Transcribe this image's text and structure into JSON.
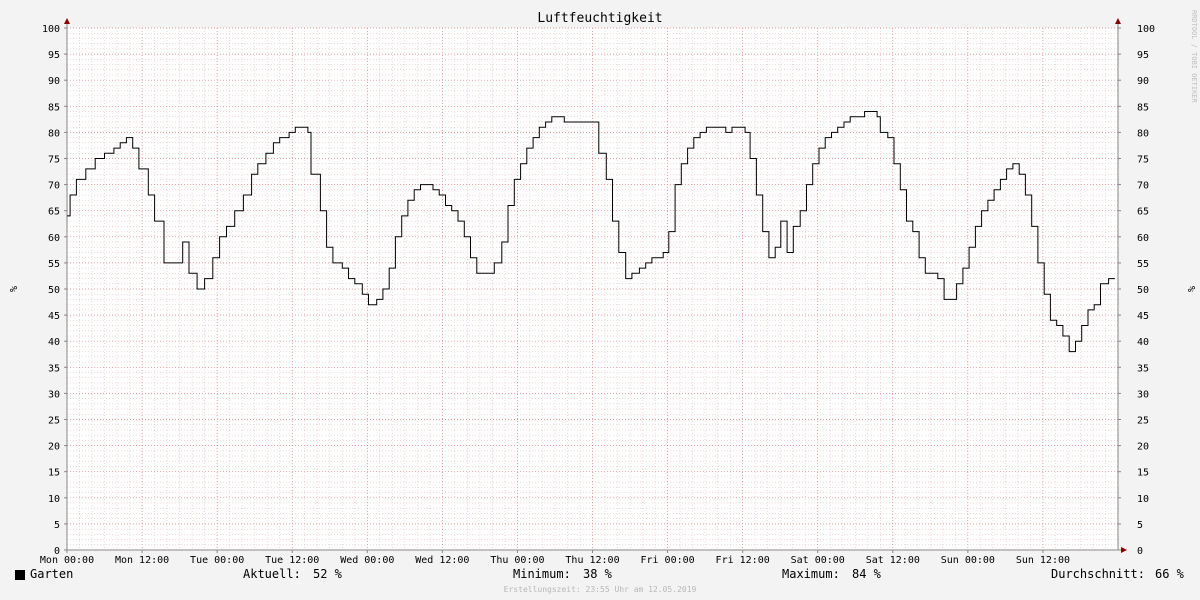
{
  "chart_data": {
    "type": "line",
    "title": "Luftfeuchtigkeit",
    "ylabel_left": "%",
    "ylabel_right": "%",
    "ylim": [
      0,
      100
    ],
    "yticks": [
      0,
      5,
      10,
      15,
      20,
      25,
      30,
      35,
      40,
      45,
      50,
      55,
      60,
      65,
      70,
      75,
      80,
      85,
      90,
      95,
      100
    ],
    "x_tick_labels": [
      "Mon 00:00",
      "Mon 12:00",
      "Tue 00:00",
      "Tue 12:00",
      "Wed 00:00",
      "Wed 12:00",
      "Thu 00:00",
      "Thu 12:00",
      "Fri 00:00",
      "Fri 12:00",
      "Sat 00:00",
      "Sat 12:00",
      "Sun 00:00",
      "Sun 12:00"
    ],
    "x_unit": "hours since Mon 00:00",
    "xlim": [
      0,
      168
    ],
    "grid": true,
    "series": [
      {
        "name": "Garten",
        "color": "#000000",
        "points": [
          [
            0,
            64
          ],
          [
            0.5,
            68
          ],
          [
            1,
            68
          ],
          [
            1.5,
            71
          ],
          [
            2.5,
            71
          ],
          [
            3,
            73
          ],
          [
            4,
            73
          ],
          [
            4.5,
            75
          ],
          [
            5.5,
            75
          ],
          [
            6,
            76
          ],
          [
            7,
            76
          ],
          [
            7.5,
            77
          ],
          [
            8.5,
            78
          ],
          [
            9.5,
            79
          ],
          [
            10.5,
            77
          ],
          [
            11,
            77
          ],
          [
            11.5,
            73
          ],
          [
            12.5,
            73
          ],
          [
            13,
            68
          ],
          [
            13.7,
            68
          ],
          [
            14,
            63
          ],
          [
            15,
            63
          ],
          [
            15.5,
            55
          ],
          [
            16.5,
            55
          ],
          [
            17,
            55
          ],
          [
            18,
            55
          ],
          [
            18.5,
            59
          ],
          [
            19.2,
            59
          ],
          [
            19.5,
            53
          ],
          [
            20.4,
            53
          ],
          [
            20.8,
            50
          ],
          [
            21.7,
            50
          ],
          [
            22,
            52
          ],
          [
            23,
            52
          ],
          [
            23.3,
            56
          ],
          [
            24,
            56
          ],
          [
            24.4,
            60
          ],
          [
            25.2,
            60
          ],
          [
            25.5,
            62
          ],
          [
            26.5,
            62
          ],
          [
            26.8,
            65
          ],
          [
            27.8,
            65
          ],
          [
            28.2,
            68
          ],
          [
            29,
            68
          ],
          [
            29.5,
            72
          ],
          [
            30.2,
            72
          ],
          [
            30.5,
            74
          ],
          [
            31.5,
            74
          ],
          [
            31.8,
            76
          ],
          [
            32.6,
            76
          ],
          [
            33,
            78
          ],
          [
            33.8,
            78
          ],
          [
            34,
            79
          ],
          [
            35,
            79
          ],
          [
            35.5,
            80
          ],
          [
            36,
            80
          ],
          [
            36.5,
            81
          ],
          [
            37.5,
            81
          ],
          [
            38,
            81
          ],
          [
            38.5,
            80
          ],
          [
            39,
            72
          ],
          [
            40,
            72
          ],
          [
            40.5,
            65
          ],
          [
            41.2,
            65
          ],
          [
            41.5,
            58
          ],
          [
            42.2,
            58
          ],
          [
            42.5,
            55
          ],
          [
            43.5,
            55
          ],
          [
            44,
            54
          ],
          [
            44.5,
            54
          ],
          [
            45,
            52
          ],
          [
            45.8,
            52
          ],
          [
            46,
            51
          ],
          [
            46.8,
            51
          ],
          [
            47.2,
            49
          ],
          [
            47.8,
            49
          ],
          [
            48.2,
            47
          ],
          [
            49.2,
            47
          ],
          [
            49.5,
            48
          ],
          [
            50.2,
            48
          ],
          [
            50.5,
            50
          ],
          [
            51.2,
            50
          ],
          [
            51.5,
            54
          ],
          [
            52.2,
            54
          ],
          [
            52.5,
            60
          ],
          [
            53.2,
            60
          ],
          [
            53.5,
            64
          ],
          [
            54.2,
            64
          ],
          [
            54.5,
            67
          ],
          [
            55.2,
            67
          ],
          [
            55.5,
            69
          ],
          [
            56.2,
            69
          ],
          [
            56.5,
            70
          ],
          [
            58,
            70
          ],
          [
            58.5,
            69
          ],
          [
            59,
            69
          ],
          [
            59.5,
            68
          ],
          [
            60.2,
            68
          ],
          [
            60.5,
            66
          ],
          [
            61.2,
            66
          ],
          [
            61.5,
            65
          ],
          [
            62.2,
            65
          ],
          [
            62.5,
            63
          ],
          [
            63.2,
            63
          ],
          [
            63.5,
            60
          ],
          [
            64.2,
            60
          ],
          [
            64.5,
            56
          ],
          [
            65.2,
            56
          ],
          [
            65.5,
            53
          ],
          [
            66.2,
            53
          ],
          [
            66.5,
            53
          ],
          [
            68,
            53
          ],
          [
            68.3,
            55
          ],
          [
            69.2,
            55
          ],
          [
            69.5,
            59
          ],
          [
            70.2,
            59
          ],
          [
            70.5,
            66
          ],
          [
            71.2,
            66
          ],
          [
            71.5,
            71
          ],
          [
            72.2,
            71
          ],
          [
            72.5,
            74
          ],
          [
            73.2,
            74
          ],
          [
            73.5,
            77
          ],
          [
            74.2,
            77
          ],
          [
            74.5,
            79
          ],
          [
            75.2,
            79
          ],
          [
            75.5,
            81
          ],
          [
            76.2,
            81
          ],
          [
            76.5,
            82
          ],
          [
            77.2,
            82
          ],
          [
            77.5,
            83
          ],
          [
            79,
            83
          ],
          [
            79.5,
            82
          ],
          [
            84,
            82
          ],
          [
            84.5,
            82
          ],
          [
            85,
            76
          ],
          [
            85.8,
            76
          ],
          [
            86.2,
            71
          ],
          [
            86.8,
            71
          ],
          [
            87.2,
            63
          ],
          [
            87.8,
            63
          ],
          [
            88.2,
            57
          ],
          [
            89,
            57
          ],
          [
            89.3,
            52
          ],
          [
            90,
            52
          ],
          [
            90.3,
            53
          ],
          [
            91.2,
            53
          ],
          [
            91.5,
            54
          ],
          [
            92.2,
            54
          ],
          [
            92.5,
            55
          ],
          [
            93.2,
            55
          ],
          [
            93.5,
            56
          ],
          [
            95,
            56
          ],
          [
            95.3,
            57
          ],
          [
            95.8,
            57
          ],
          [
            96.2,
            61
          ],
          [
            96.8,
            61
          ],
          [
            97.2,
            70
          ],
          [
            97.8,
            70
          ],
          [
            98.2,
            74
          ],
          [
            98.8,
            74
          ],
          [
            99.2,
            77
          ],
          [
            99.8,
            77
          ],
          [
            100.2,
            79
          ],
          [
            100.8,
            79
          ],
          [
            101.2,
            80
          ],
          [
            101.8,
            80
          ],
          [
            102.2,
            81
          ],
          [
            105,
            81
          ],
          [
            105.3,
            80
          ],
          [
            106,
            80
          ],
          [
            106.3,
            81
          ],
          [
            107,
            81
          ],
          [
            107.3,
            81
          ],
          [
            108,
            81
          ],
          [
            108.4,
            80
          ],
          [
            108.8,
            80
          ],
          [
            109.2,
            75
          ],
          [
            109.8,
            75
          ],
          [
            110.2,
            68
          ],
          [
            110.8,
            68
          ],
          [
            111.2,
            61
          ],
          [
            111.8,
            61
          ],
          [
            112.2,
            56
          ],
          [
            112.8,
            56
          ],
          [
            113.2,
            58
          ],
          [
            113.8,
            58
          ],
          [
            114.1,
            63
          ],
          [
            114.8,
            63
          ],
          [
            115.1,
            57
          ],
          [
            115.7,
            57
          ],
          [
            116.1,
            62
          ],
          [
            116.8,
            62
          ],
          [
            117.2,
            65
          ],
          [
            117.8,
            65
          ],
          [
            118.2,
            70
          ],
          [
            118.8,
            70
          ],
          [
            119.2,
            74
          ],
          [
            119.8,
            74
          ],
          [
            120.2,
            77
          ],
          [
            120.8,
            77
          ],
          [
            121.2,
            79
          ],
          [
            121.8,
            79
          ],
          [
            122.2,
            80
          ],
          [
            122.8,
            80
          ],
          [
            123.2,
            81
          ],
          [
            123.8,
            81
          ],
          [
            124.2,
            82
          ],
          [
            124.8,
            82
          ],
          [
            125.2,
            83
          ],
          [
            127,
            83
          ],
          [
            127.5,
            84
          ],
          [
            128.5,
            84
          ],
          [
            129,
            84
          ],
          [
            129.5,
            83
          ],
          [
            130,
            80
          ],
          [
            130.8,
            80
          ],
          [
            131.2,
            79
          ],
          [
            131.8,
            79
          ],
          [
            132.2,
            74
          ],
          [
            132.8,
            74
          ],
          [
            133.2,
            69
          ],
          [
            133.8,
            69
          ],
          [
            134.2,
            63
          ],
          [
            134.8,
            63
          ],
          [
            135.2,
            61
          ],
          [
            135.8,
            61
          ],
          [
            136.2,
            56
          ],
          [
            136.8,
            56
          ],
          [
            137.2,
            53
          ],
          [
            137.8,
            53
          ],
          [
            138.2,
            53
          ],
          [
            138.8,
            53
          ],
          [
            139.2,
            52
          ],
          [
            139.8,
            52
          ],
          [
            140.2,
            48
          ],
          [
            140.8,
            48
          ],
          [
            141.2,
            48
          ],
          [
            141.8,
            48
          ],
          [
            142.2,
            51
          ],
          [
            142.8,
            51
          ],
          [
            143.2,
            54
          ],
          [
            143.8,
            54
          ],
          [
            144.2,
            58
          ],
          [
            144.8,
            58
          ],
          [
            145.2,
            62
          ],
          [
            145.8,
            62
          ],
          [
            146.2,
            65
          ],
          [
            146.8,
            65
          ],
          [
            147.2,
            67
          ],
          [
            147.8,
            67
          ],
          [
            148.2,
            69
          ],
          [
            148.8,
            69
          ],
          [
            149.2,
            71
          ],
          [
            149.8,
            71
          ],
          [
            150.2,
            73
          ],
          [
            150.8,
            73
          ],
          [
            151.2,
            74
          ],
          [
            151.8,
            74
          ],
          [
            152.2,
            72
          ],
          [
            152.8,
            72
          ],
          [
            153.2,
            68
          ],
          [
            153.8,
            68
          ],
          [
            154.2,
            62
          ],
          [
            154.8,
            62
          ],
          [
            155.2,
            55
          ],
          [
            155.8,
            55
          ],
          [
            156.2,
            49
          ],
          [
            156.8,
            49
          ],
          [
            157.2,
            44
          ],
          [
            157.8,
            44
          ],
          [
            158.2,
            43
          ],
          [
            158.8,
            43
          ],
          [
            159.2,
            41
          ],
          [
            159.8,
            41
          ],
          [
            160.2,
            38
          ],
          [
            160.8,
            38
          ],
          [
            161.2,
            40
          ],
          [
            161.8,
            40
          ],
          [
            162.2,
            43
          ],
          [
            162.8,
            43
          ],
          [
            163.2,
            46
          ],
          [
            163.8,
            46
          ],
          [
            164.2,
            47
          ],
          [
            164.8,
            47
          ],
          [
            165.2,
            51
          ],
          [
            166.2,
            51
          ],
          [
            166.5,
            52
          ],
          [
            167,
            52
          ],
          [
            167.5,
            52
          ]
        ]
      }
    ],
    "legend": {
      "position": "bottom",
      "series_label": "Garten",
      "current_label": "Aktuell:",
      "current_value": "52 %",
      "min_label": "Minimum:",
      "min_value": "38 %",
      "max_label": "Maximum:",
      "max_value": "84 %",
      "avg_label": "Durchschnitt:",
      "avg_value": "66 %"
    }
  },
  "footer": "Erstellungszeit: 23:55 Uhr am 12.05.2019",
  "watermark": "RRDTOOL / TOBI OETIKER",
  "colors": {
    "background": "#f3f3f3",
    "plot_background": "#ffffff",
    "grid_minor": "#e3b8b8",
    "grid_major": "#e08080",
    "axis": "#888888",
    "arrow": "#880000",
    "line": "#000000"
  }
}
